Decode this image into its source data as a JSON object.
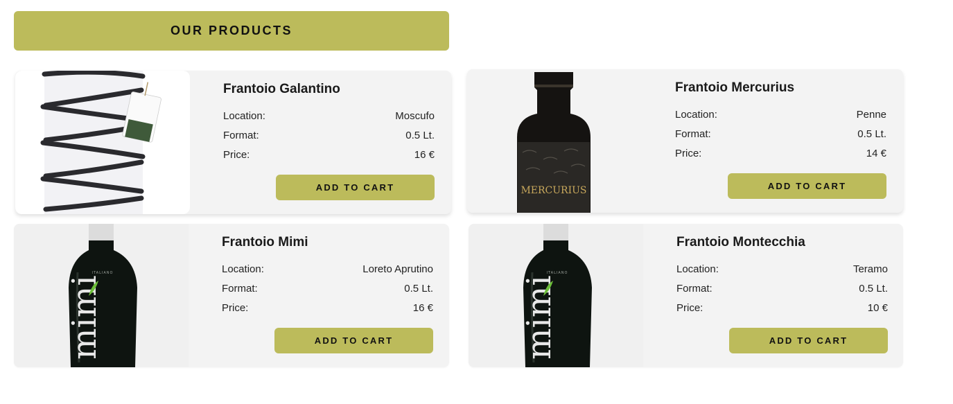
{
  "header": {
    "title": "OUR PRODUCTS"
  },
  "labels": {
    "location": "Location:",
    "format": "Format:",
    "price": "Price:"
  },
  "products": [
    {
      "name": "Frantoio Galantino",
      "location": "Moscufo",
      "format": "0.5 Lt.",
      "price": "16 €",
      "button": "ADD TO CART",
      "image": "galantino-bottle"
    },
    {
      "name": "Frantoio Mercurius",
      "location": "Penne",
      "format": "0.5 Lt.",
      "price": "14 €",
      "button": "ADD TO CART",
      "image": "mercurius-bottle"
    },
    {
      "name": "Frantoio Mimi",
      "location": "Loreto Aprutino",
      "format": "0.5 Lt.",
      "price": "16 €",
      "button": "ADD TO CART",
      "image": "mimi-bottle"
    },
    {
      "name": "Frantoio Montecchia",
      "location": "Teramo",
      "format": "0.5 Lt.",
      "price": "10 €",
      "button": "ADD TO CART",
      "image": "mimi-bottle"
    }
  ],
  "colors": {
    "accent": "#bcbb5b",
    "card": "#f3f3f3",
    "text": "#111111"
  }
}
